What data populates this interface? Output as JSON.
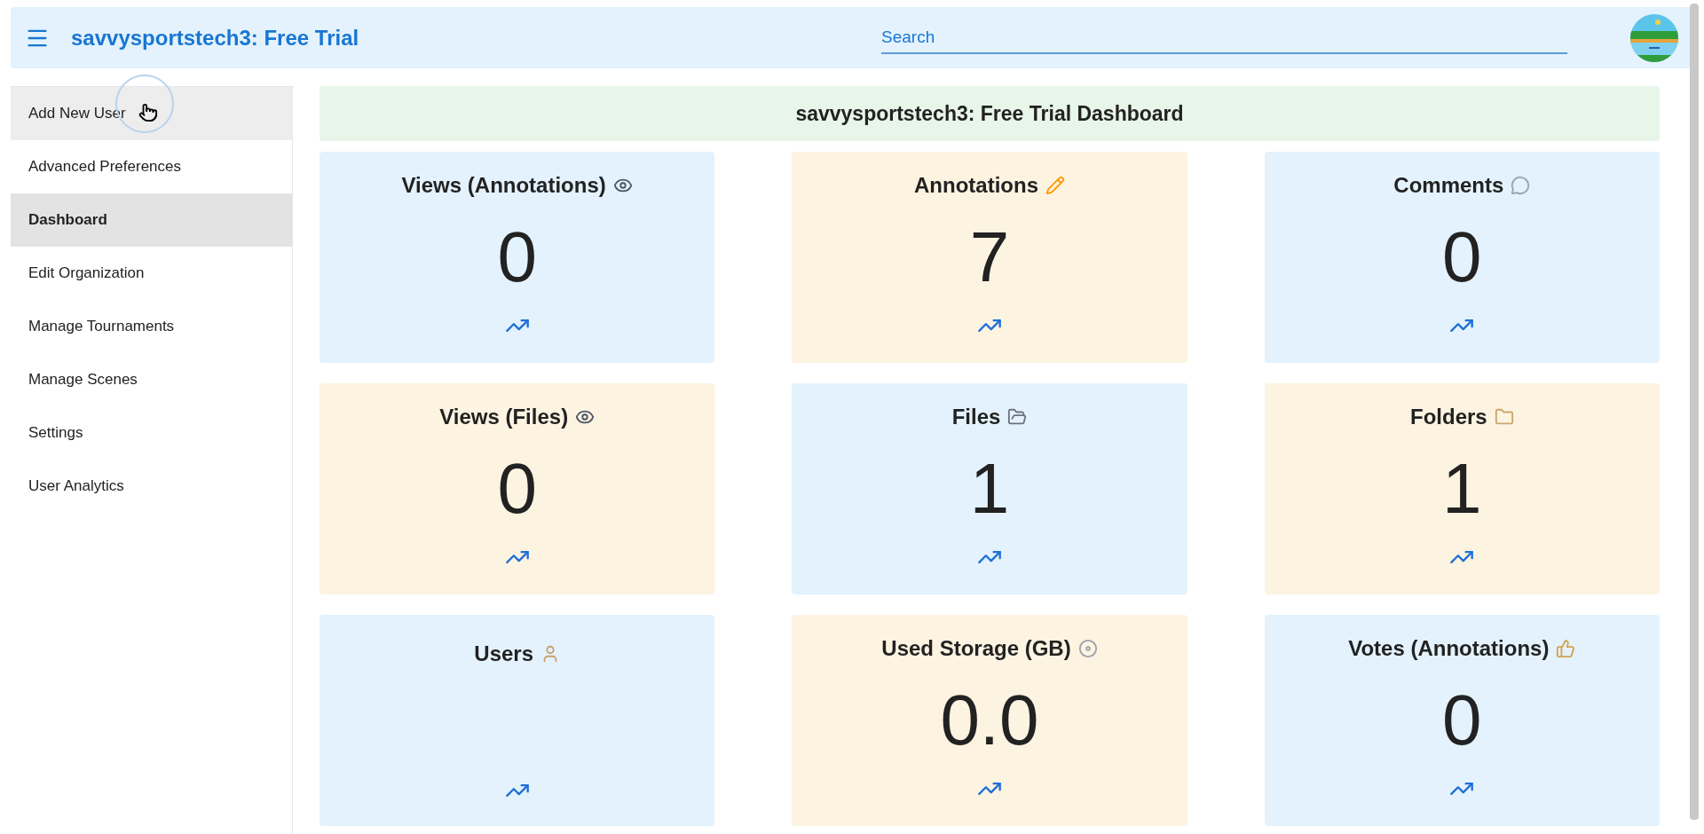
{
  "app_bar": {
    "title": "savvysportstech3: Free Trial",
    "search": {
      "placeholder": "Search"
    }
  },
  "sidebar": {
    "items": [
      {
        "label": "Add New User",
        "selected": false,
        "hovered": true
      },
      {
        "label": "Advanced Preferences",
        "selected": false,
        "hovered": false
      },
      {
        "label": "Dashboard",
        "selected": true,
        "hovered": false
      },
      {
        "label": "Edit Organization",
        "selected": false,
        "hovered": false
      },
      {
        "label": "Manage Tournaments",
        "selected": false,
        "hovered": false
      },
      {
        "label": "Manage Scenes",
        "selected": false,
        "hovered": false
      },
      {
        "label": "Settings",
        "selected": false,
        "hovered": false
      },
      {
        "label": "User Analytics",
        "selected": false,
        "hovered": false
      }
    ]
  },
  "dashboard": {
    "title": "savvysportstech3: Free Trial Dashboard",
    "cards": [
      {
        "title": "Views (Annotations)",
        "value": "0",
        "color": "#e3f2fc"
      },
      {
        "title": "Annotations",
        "value": "7",
        "color": "#fdf3e1"
      },
      {
        "title": "Comments",
        "value": "0",
        "color": "#e3f2fc"
      },
      {
        "title": "Views (Files)",
        "value": "0",
        "color": "#fdf3e1"
      },
      {
        "title": "Files",
        "value": "1",
        "color": "#e3f2fc"
      },
      {
        "title": "Folders",
        "value": "1",
        "color": "#fdf3e1"
      },
      {
        "title": "Users",
        "color": "#e3f2fc"
      },
      {
        "title": "Used Storage (GB)",
        "value": "0.0",
        "color": "#fdf3e1"
      },
      {
        "title": "Votes (Annotations)",
        "value": "0",
        "color": "#e3f2fc"
      }
    ]
  }
}
